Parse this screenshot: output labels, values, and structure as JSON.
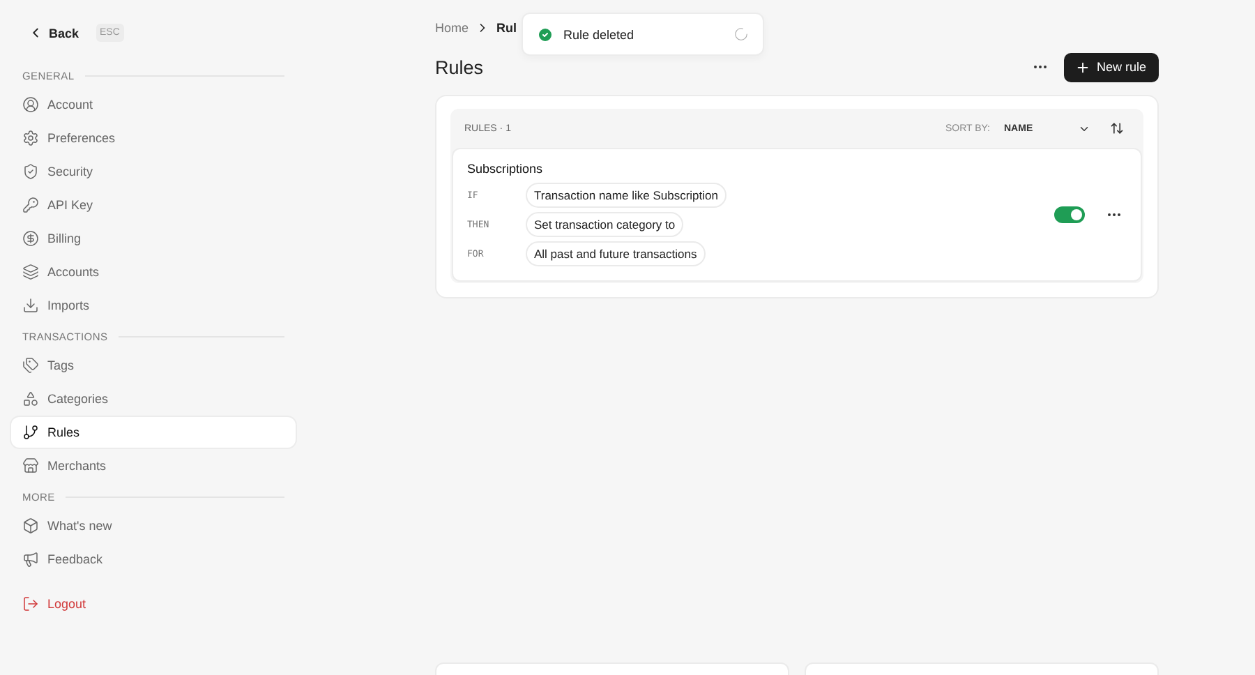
{
  "sidebar": {
    "back": "Back",
    "shortcut": "ESC",
    "sections": [
      {
        "title": "GENERAL",
        "items": [
          {
            "label": "Account",
            "selected": false
          },
          {
            "label": "Preferences",
            "selected": false
          },
          {
            "label": "Security",
            "selected": false
          },
          {
            "label": "API Key",
            "selected": false
          },
          {
            "label": "Billing",
            "selected": false
          },
          {
            "label": "Accounts",
            "selected": false
          },
          {
            "label": "Imports",
            "selected": false
          }
        ]
      },
      {
        "title": "TRANSACTIONS",
        "items": [
          {
            "label": "Tags",
            "selected": false
          },
          {
            "label": "Categories",
            "selected": false
          },
          {
            "label": "Rules",
            "selected": true
          },
          {
            "label": "Merchants",
            "selected": false
          }
        ]
      },
      {
        "title": "MORE",
        "items": [
          {
            "label": "What's new",
            "selected": false
          },
          {
            "label": "Feedback",
            "selected": false
          }
        ]
      }
    ],
    "logout": "Logout"
  },
  "breadcrumb": [
    "Home",
    "Rul"
  ],
  "toast": {
    "message": "Rule deleted"
  },
  "page": {
    "title": "Rules",
    "new_button": "New rule"
  },
  "rules_panel": {
    "heading": "RULES",
    "separator": "·",
    "count": "1",
    "sort_label": "SORT BY:",
    "sort_value": "NAME",
    "rules": [
      {
        "name": "Subscriptions",
        "on": true,
        "clauses": [
          {
            "keyword": "IF",
            "text": "Transaction name like Subscription"
          },
          {
            "keyword": "THEN",
            "text": "Set transaction category to"
          },
          {
            "keyword": "FOR",
            "text": "All past and future transactions"
          }
        ]
      }
    ]
  }
}
